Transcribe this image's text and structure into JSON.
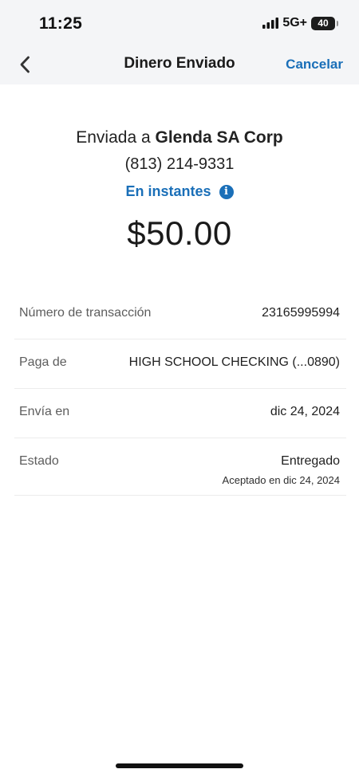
{
  "status_bar": {
    "time": "11:25",
    "network": "5G+",
    "battery_level": "40",
    "icons": [
      "signal-bars-icon",
      "battery-icon"
    ]
  },
  "nav": {
    "title": "Dinero Enviado",
    "back_icon": "chevron-left-icon",
    "cancel_label": "Cancelar"
  },
  "summary": {
    "sent_to_prefix": "Enviada a ",
    "recipient_name": "Glenda SA Corp",
    "recipient_phone": "(813) 214-9331",
    "speed_label": "En instantes",
    "info_icon": "info-icon",
    "amount": "$50.00"
  },
  "details": {
    "rows": [
      {
        "label": "Número de transacción",
        "value": "23165995994"
      },
      {
        "label": "Paga de",
        "value": "HIGH SCHOOL CHECKING (...0890)"
      },
      {
        "label": "Envía en",
        "value": "dic 24, 2024"
      },
      {
        "label": "Estado",
        "value": "Entregado",
        "sub": "Aceptado en dic 24, 2024"
      }
    ]
  },
  "colors": {
    "accent": "#1a6fb8",
    "header_bg": "#f4f5f7",
    "text": "#222222",
    "muted_text": "#5d5d5d",
    "divider": "#ececec"
  }
}
